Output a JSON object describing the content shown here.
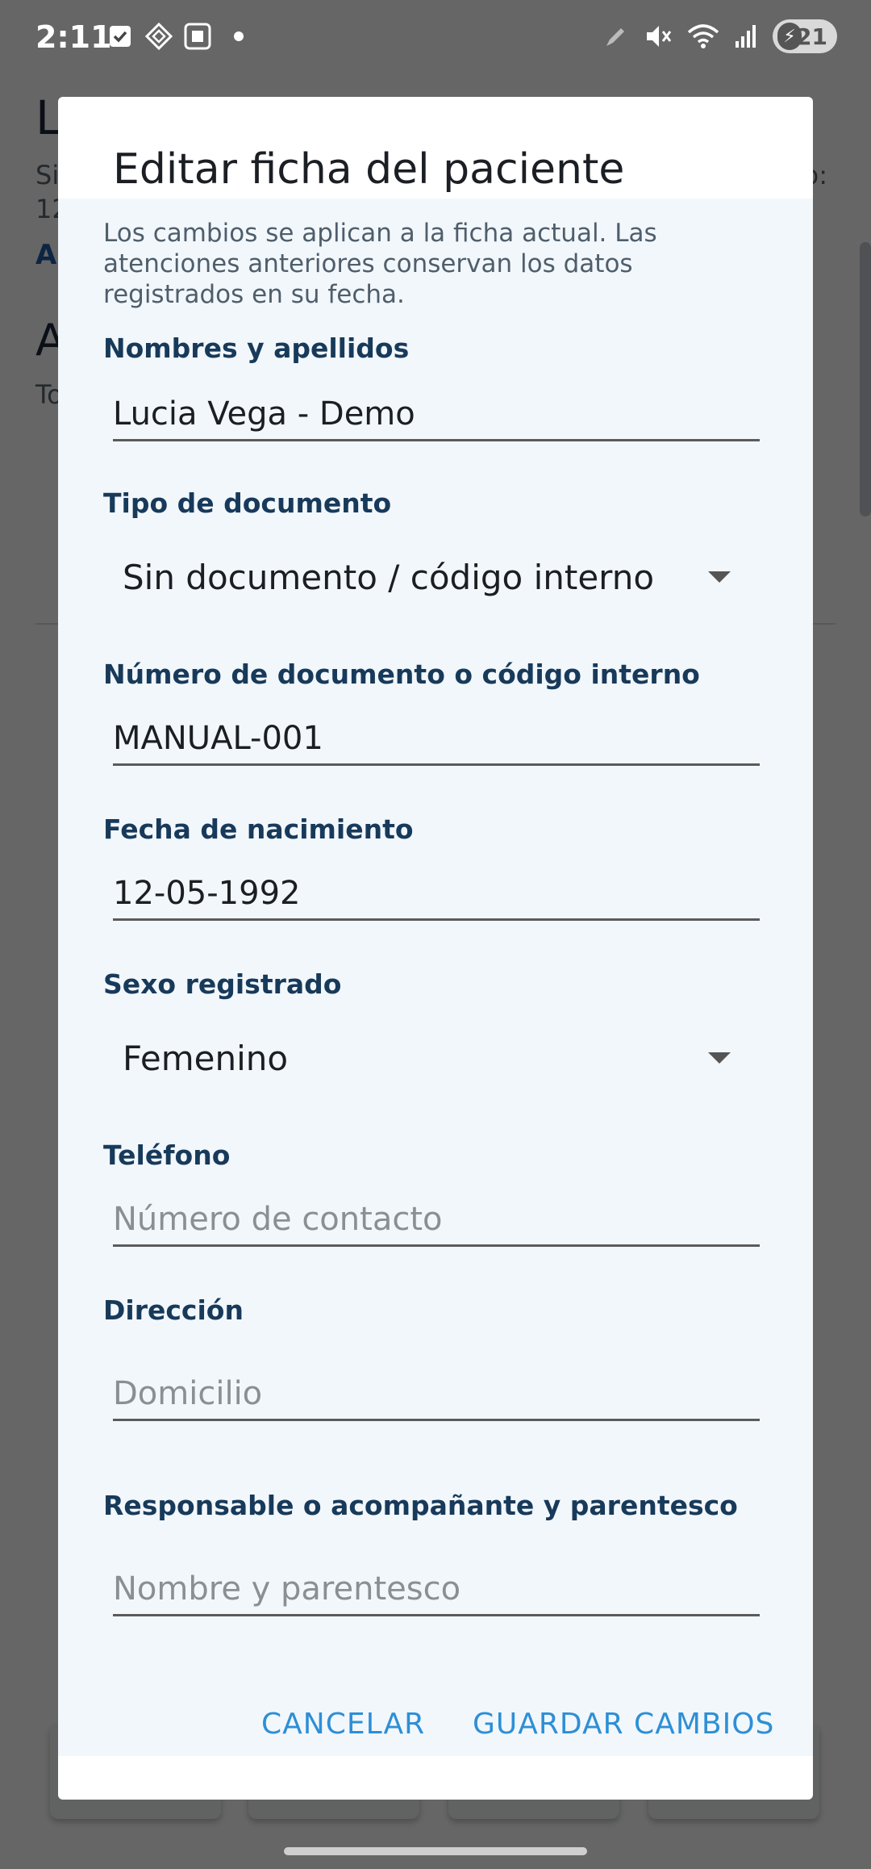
{
  "status_bar": {
    "time": "2:11",
    "battery": "21"
  },
  "background": {
    "title": "L",
    "subtitle_line1": "Si",
    "subtitle_line2": "12",
    "subtitle_trail": "o:",
    "link": "A",
    "section_title": "A",
    "section_sub": "To"
  },
  "dialog": {
    "title": "Editar ficha del paciente",
    "info": "Los cambios se aplican a la ficha actual. Las atenciones anteriores conservan los datos registrados en su fecha.",
    "fields": {
      "name": {
        "label": "Nombres y apellidos",
        "value": "Lucia Vega - Demo"
      },
      "doc_type": {
        "label": "Tipo de documento",
        "value": "Sin documento / código interno"
      },
      "doc_number": {
        "label": "Número de documento o código interno",
        "value": "MANUAL-001"
      },
      "birth_date": {
        "label": "Fecha de nacimiento",
        "value": "12-05-1992"
      },
      "sex": {
        "label": "Sexo registrado",
        "value": "Femenino"
      },
      "phone": {
        "label": "Teléfono",
        "placeholder": "Número de contacto"
      },
      "address": {
        "label": "Dirección",
        "placeholder": "Domicilio"
      },
      "guardian": {
        "label": "Responsable o acompañante y parentesco",
        "placeholder": "Nombre y parentesco"
      }
    },
    "actions": {
      "cancel": "CANCELAR",
      "save": "GUARDAR CAMBIOS"
    }
  },
  "colors": {
    "accent": "#2d8fd6",
    "label": "#183a5a",
    "dialog_body": "#f2f7fc"
  }
}
